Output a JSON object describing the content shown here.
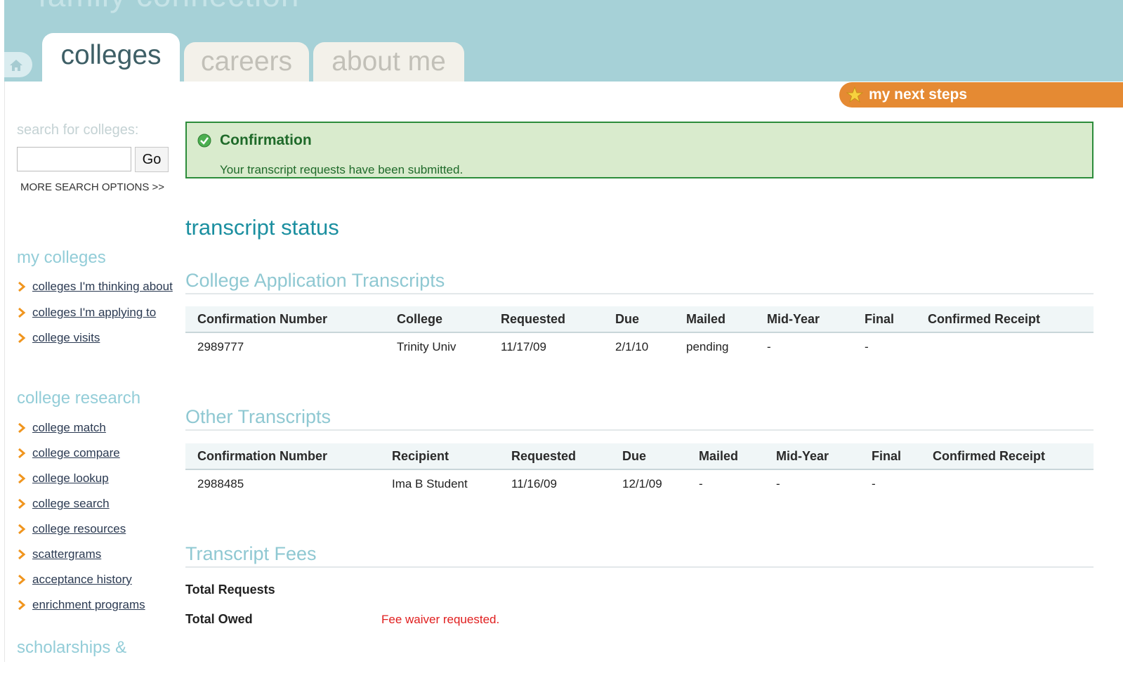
{
  "header": {
    "tabs": [
      {
        "label": "colleges",
        "active": true
      },
      {
        "label": "careers",
        "active": false
      },
      {
        "label": "about me",
        "active": false
      }
    ]
  },
  "next_steps": {
    "label": "my next steps"
  },
  "sidebar": {
    "search": {
      "label": "search for colleges:",
      "value": "",
      "button": "Go",
      "more": "MORE SEARCH OPTIONS >>"
    },
    "sections": [
      {
        "heading": "my colleges",
        "items": [
          "colleges I'm thinking about",
          "colleges I'm applying to",
          "college visits"
        ]
      },
      {
        "heading": "college research",
        "items": [
          "college match",
          "college compare",
          "college lookup",
          "college search",
          "college resources",
          "scattergrams",
          "acceptance history",
          "enrichment programs"
        ]
      },
      {
        "heading": "scholarships &",
        "items": []
      }
    ]
  },
  "confirmation": {
    "title": "Confirmation",
    "message": "Your transcript requests have been submitted."
  },
  "page_title": "transcript status",
  "college_transcripts": {
    "title": "College Application Transcripts",
    "columns": [
      "Confirmation Number",
      "College",
      "Requested",
      "Due",
      "Mailed",
      "Mid-Year",
      "Final",
      "Confirmed Receipt"
    ],
    "rows": [
      [
        "2989777",
        "Trinity Univ",
        "11/17/09",
        "2/1/10",
        "pending",
        "-",
        "-",
        ""
      ]
    ]
  },
  "other_transcripts": {
    "title": "Other Transcripts",
    "columns": [
      "Confirmation Number",
      "Recipient",
      "Requested",
      "Due",
      "Mailed",
      "Mid-Year",
      "Final",
      "Confirmed Receipt"
    ],
    "rows": [
      [
        "2988485",
        "Ima B Student",
        "11/16/09",
        "12/1/09",
        "-",
        "-",
        "-",
        ""
      ]
    ]
  },
  "fees": {
    "title": "Transcript Fees",
    "total_requests_label": "Total Requests",
    "total_requests_value": "",
    "total_owed_label": "Total Owed",
    "total_owed_value": "Fee waiver requested."
  },
  "colors": {
    "header": "#a6d1d7",
    "accent_orange": "#e58a33",
    "confirm_bg": "#d9ebcd",
    "confirm_border": "#2c8c3a",
    "title_teal": "#1b8fa0",
    "error_red": "#e01e1e"
  },
  "icons": {
    "home": "home-icon",
    "star": "star-icon",
    "check": "check-circle-icon",
    "chevron": "chevron-right-icon"
  }
}
